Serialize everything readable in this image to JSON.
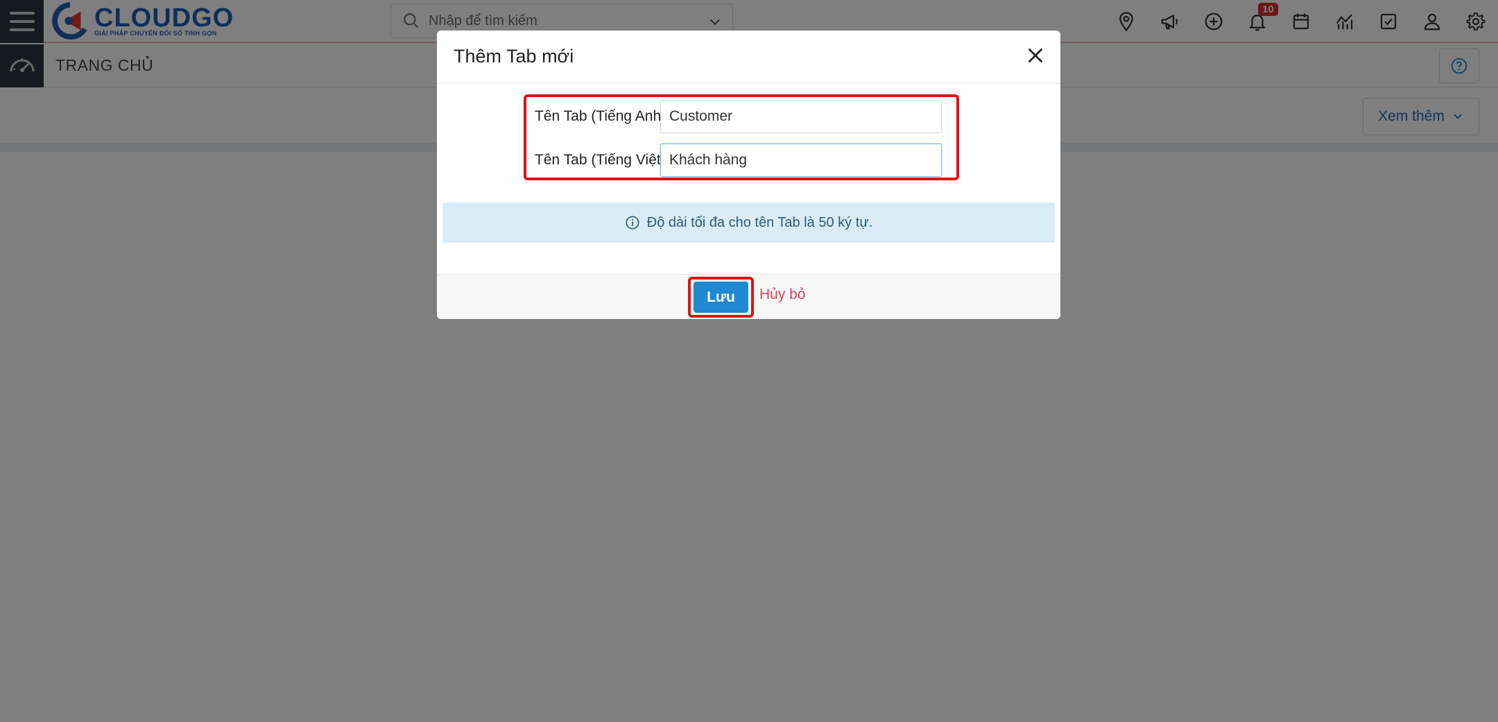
{
  "app": {
    "logo_name": "CLOUDGO",
    "logo_tagline": "GIẢI PHÁP CHUYỂN ĐỔI SỐ TINH GỌN",
    "search_placeholder": "Nhập để tìm kiếm",
    "notification_count": "10",
    "top_icons": [
      "location-pin-icon",
      "megaphone-icon",
      "add-circle-icon",
      "bell-icon",
      "calendar-icon",
      "chart-icon",
      "task-check-icon",
      "user-icon",
      "gear-icon"
    ]
  },
  "page": {
    "title": "TRANG CHỦ",
    "more_button": "Xem thêm"
  },
  "modal": {
    "title": "Thêm Tab mới",
    "fields": [
      {
        "label": "Tên Tab (Tiếng Anh)",
        "required_mark": "*",
        "value": "Customer"
      },
      {
        "label": "Tên Tab (Tiếng Việt)",
        "required_mark": "*",
        "value": "Khách hàng"
      }
    ],
    "info_text": "Độ dài tối đa cho tên Tab là 50 ký tự.",
    "save_label": "Lưu",
    "cancel_label": "Hủy bỏ"
  },
  "colors": {
    "highlight_border": "#e01212",
    "primary": "#1e88d0",
    "cancel": "#d6435a",
    "info_bg": "#d9ecf5"
  }
}
